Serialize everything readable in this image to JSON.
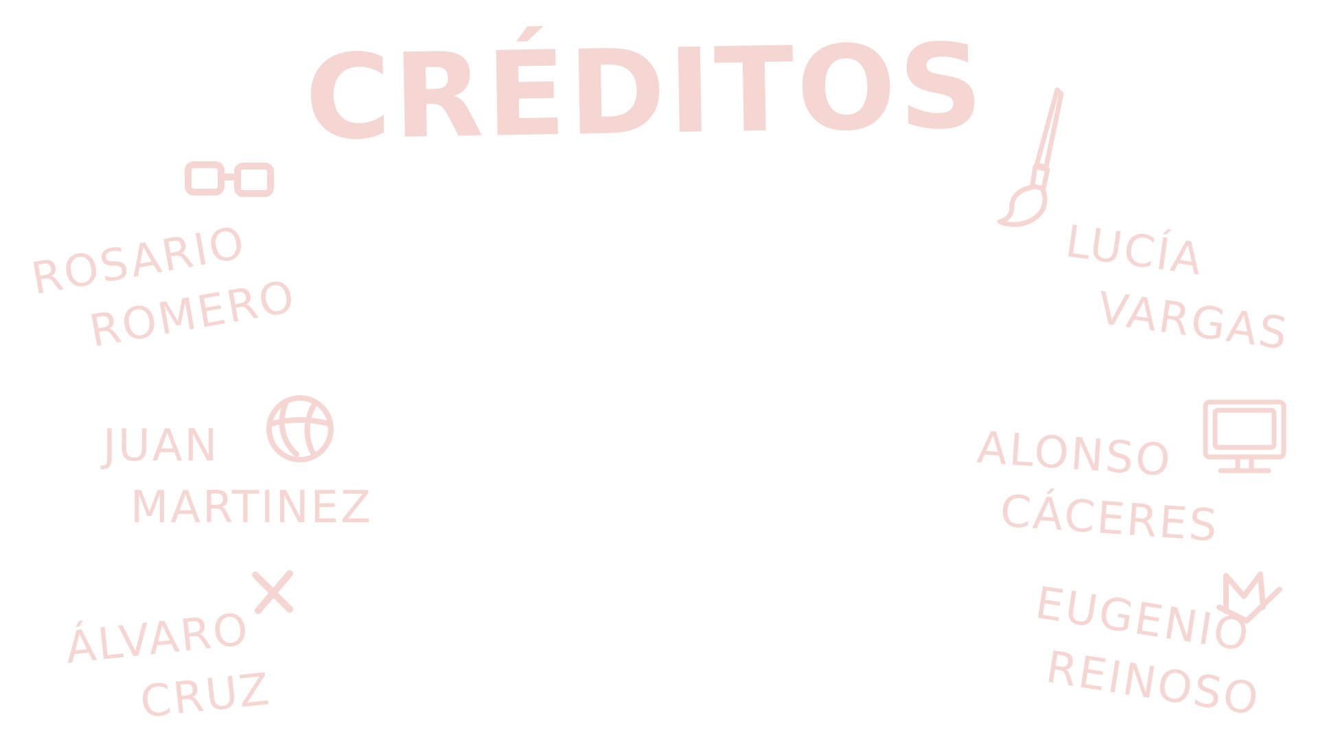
{
  "title": "CRÉDITOS",
  "colors": {
    "ink": "#f5d6d3",
    "background": "#ffffff"
  },
  "credits": [
    {
      "first": "ROSARIO",
      "last": "ROMERO",
      "icon": "glasses-icon"
    },
    {
      "first": "JUAN",
      "last": "MARTINEZ",
      "icon": "basketball-icon"
    },
    {
      "first": "ÁLVARO",
      "last": "CRUZ",
      "icon": "x-mark-icon"
    },
    {
      "first": "LUCÍA",
      "last": "VARGAS",
      "icon": "paintbrush-icon"
    },
    {
      "first": "ALONSO",
      "last": "CÁCERES",
      "icon": "computer-monitor-icon"
    },
    {
      "first": "EUGENIO",
      "last": "REINOSO",
      "icon": "mail-icon"
    }
  ]
}
